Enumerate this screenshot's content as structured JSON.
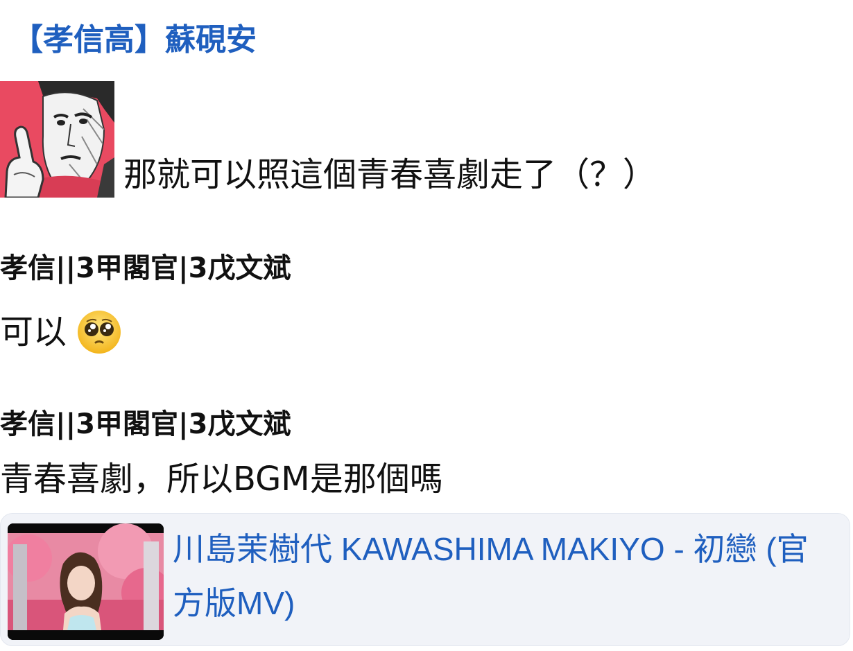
{
  "post": {
    "author": "【孝信高】蘇硯安",
    "message": "那就可以照這個青春喜劇走了（？）",
    "sticker": "pointing-man-sticker"
  },
  "replies": [
    {
      "author": "孝信||3甲閣官|3戊文斌",
      "text": "可以",
      "emoji": "pleading-face-emoji"
    },
    {
      "author": "孝信||3甲閣官|3戊文斌",
      "text": "青春喜劇，所以BGM是那個嗎"
    }
  ],
  "link_card": {
    "title": "川島茉樹代 KAWASHIMA MAKIYO - 初戀 (官方版MV)",
    "thumbnail": "music-video-thumbnail"
  },
  "colors": {
    "link": "#1f5fbf",
    "card_bg": "#f1f3f8",
    "sticker_bg": "#e94a61"
  }
}
